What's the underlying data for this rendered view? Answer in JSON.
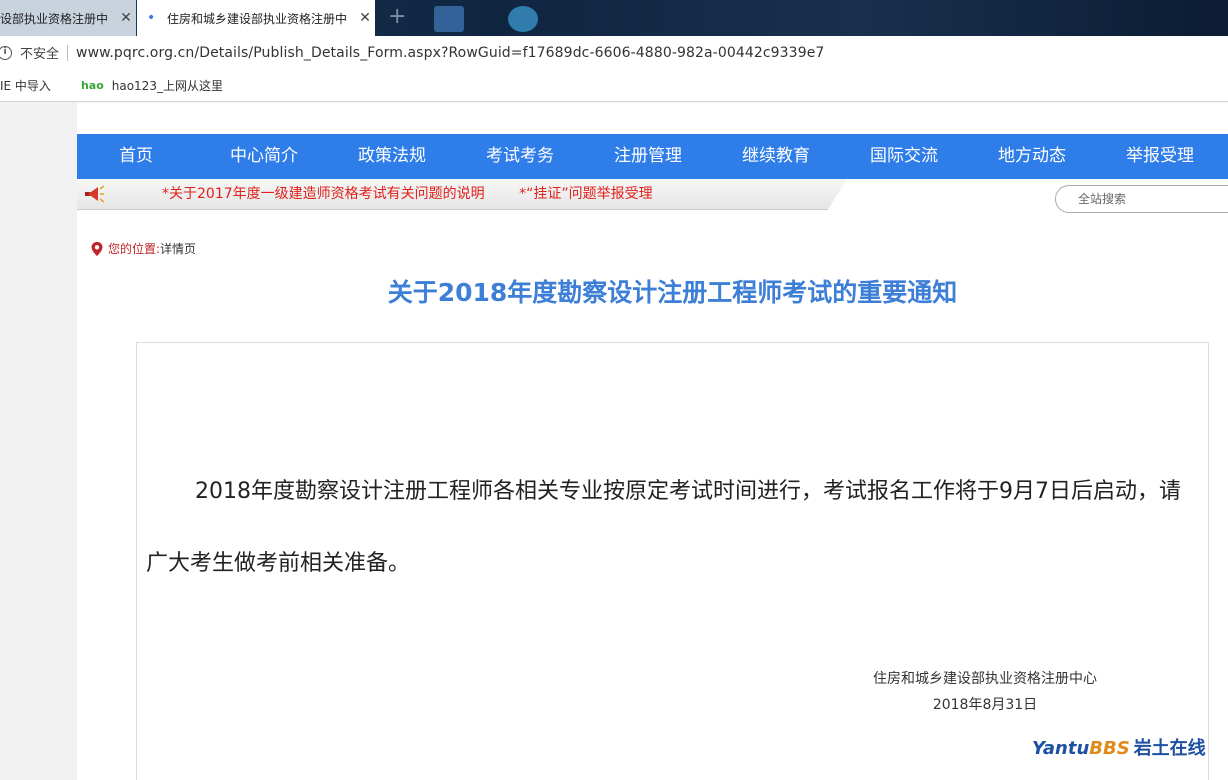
{
  "browser": {
    "tabs": [
      {
        "title": "设部执业资格注册中",
        "active": false
      },
      {
        "title": "住房和城乡建设部执业资格注册中",
        "active": true
      }
    ],
    "new_tab": "+",
    "close_glyph": "✕",
    "security_label": "不安全",
    "url": "www.pqrc.org.cn/Details/Publish_Details_Form.aspx?RowGuid=f17689dc-6606-4880-982a-00442c9339e7",
    "bookmarks": [
      {
        "label": "IE 中导入"
      },
      {
        "label": "hao123_上网从这里"
      }
    ],
    "bookmark_icon_text": "hao"
  },
  "nav": {
    "items": [
      "首页",
      "中心简介",
      "政策法规",
      "考试考务",
      "注册管理",
      "继续教育",
      "国际交流",
      "地方动态",
      "举报受理"
    ]
  },
  "ticker": {
    "items": [
      "*关于2017年度一级建造师资格考试有关问题的说明",
      "*“挂证”问题举报受理"
    ]
  },
  "search": {
    "placeholder": "全站搜索"
  },
  "location": {
    "label": "您的位置:",
    "value": "详情页"
  },
  "article": {
    "title": "关于2018年度勘察设计注册工程师考试的重要通知",
    "body": "2018年度勘察设计注册工程师各相关专业按原定考试时间进行，考试报名工作将于9月7日后启动，请广大考生做考前相关准备。",
    "signature_org": "住房和城乡建设部执业资格注册中心",
    "signature_date": "2018年8月31日"
  },
  "watermark": {
    "part1": "Yantu",
    "part2": "BBS",
    "part3": "岩土在线"
  },
  "colors": {
    "nav": "#2f7de9",
    "title": "#3d7fd6",
    "ticker_text": "#e0211b",
    "location_label": "#c0242b"
  }
}
